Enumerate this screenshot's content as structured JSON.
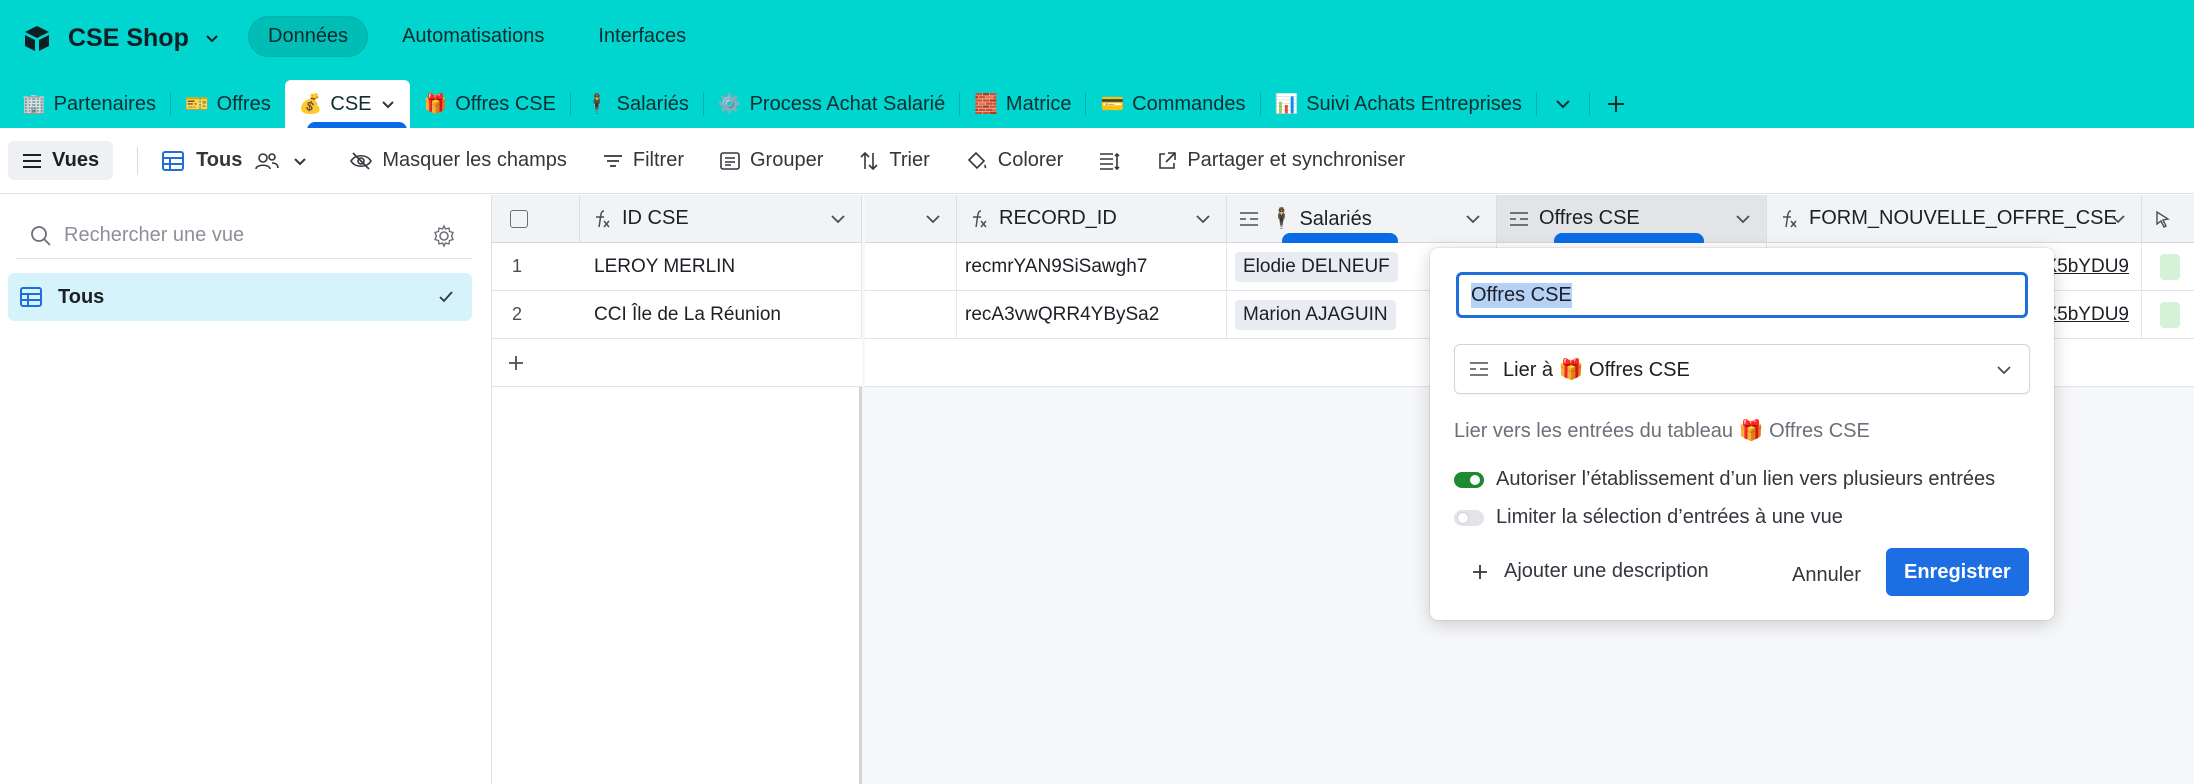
{
  "app": {
    "name": "CSE Shop",
    "nav": [
      "Données",
      "Automatisations",
      "Interfaces"
    ]
  },
  "tabs": [
    {
      "emoji": "🏢",
      "label": "Partenaires"
    },
    {
      "emoji": "🎫",
      "label": "Offres"
    },
    {
      "emoji": "💰",
      "label": "CSE"
    },
    {
      "emoji": "🎁",
      "label": "Offres CSE"
    },
    {
      "emoji": "🕴️",
      "label": "Salariés"
    },
    {
      "emoji": "⚙️",
      "label": "Process Achat Salarié"
    },
    {
      "emoji": "🧱",
      "label": "Matrice"
    },
    {
      "emoji": "💳",
      "label": "Commandes"
    },
    {
      "emoji": "📊",
      "label": "Suivi Achats Entreprises"
    }
  ],
  "toolbar": {
    "views": "Vues",
    "current_view": "Tous",
    "hide_fields": "Masquer les champs",
    "filter": "Filtrer",
    "group": "Grouper",
    "sort": "Trier",
    "color": "Colorer",
    "share": "Partager et synchroniser"
  },
  "sidebar": {
    "search_placeholder": "Rechercher une vue",
    "views": [
      {
        "label": "Tous"
      }
    ]
  },
  "grid": {
    "columns": {
      "id": "ID CSE",
      "record": "RECORD_ID",
      "salaries": "🕴️ Salariés",
      "offres": "Offres CSE",
      "form": "FORM_NOUVELLE_OFFRE_CSE"
    },
    "rows": [
      {
        "num": "1",
        "id": "LEROY MERLIN",
        "record": "recmrYAN9SiSawgh7",
        "salarie": "Elodie DELNEUF",
        "form": "X5bYDU9"
      },
      {
        "num": "2",
        "id": "CCI Île de La Réunion",
        "record": "recA3vwQRR4YBySa2",
        "salarie": "Marion AJAGUIN",
        "form": "X5bYDU9"
      }
    ]
  },
  "popup": {
    "field_name": "Offres CSE",
    "type": "Lier à 🎁 Offres CSE",
    "help": "Lier vers les entrées du tableau 🎁 Offres CSE",
    "opt1": "Autoriser l’établissement d’un lien vers plusieurs entrées",
    "opt1_on": true,
    "opt2": "Limiter la sélection d’entrées à une vue",
    "opt2_on": false,
    "add_description": "Ajouter une description",
    "cancel": "Annuler",
    "save": "Enregistrer"
  },
  "colors": {
    "header": "#00d6cf",
    "accent": "#1c6ee2",
    "toggle_on": "#1d8a2e",
    "selected_view": "#d6f3fb"
  }
}
